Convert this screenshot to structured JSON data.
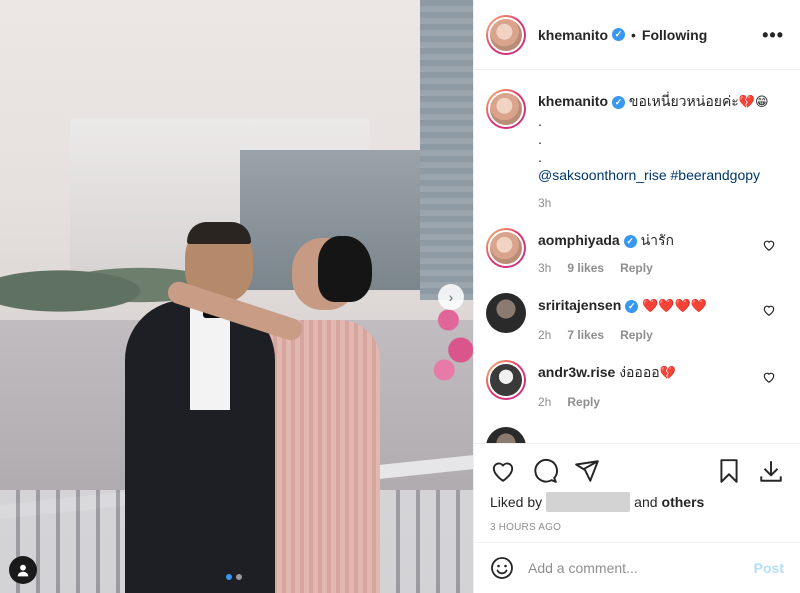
{
  "post": {
    "username": "khemanito",
    "follow_separator": "•",
    "follow_state": "Following",
    "more_label": "•••"
  },
  "caption": {
    "username": "khemanito",
    "text": "ขอเหนี่ยวหน่อยค่ะ",
    "emoji_1": "💔",
    "emoji_2": "😁",
    "dot_line_1": ".",
    "dot_line_2": ".",
    "dot_line_3": ".",
    "mention": "@saksoonthorn_rise",
    "hashtag": "#beerandgopy",
    "time": "3h"
  },
  "comments": [
    {
      "username": "aomphiyada",
      "verified": true,
      "text": "น่ารัก",
      "time": "3h",
      "likes": "9 likes",
      "reply": "Reply"
    },
    {
      "username": "sriritajensen",
      "verified": true,
      "text": "❤️❤️❤️❤️",
      "time": "2h",
      "likes": "7 likes",
      "reply": "Reply"
    },
    {
      "username": "andr3w.rise",
      "verified": false,
      "text": "ง่ออออ",
      "emoji": "💔",
      "time": "2h",
      "likes": "",
      "reply": "Reply"
    }
  ],
  "likes": {
    "prefix": "Liked by",
    "connector": "and",
    "others": "others"
  },
  "timestamp": "3 HOURS AGO",
  "add_comment": {
    "placeholder": "Add a comment...",
    "post_label": "Post"
  },
  "carousel": {
    "current": 1,
    "total": 2,
    "next_label": "›"
  },
  "colors": {
    "accent": "#3897f0",
    "link": "#00376b",
    "muted": "#8e8e8e",
    "post_disabled": "#b2dffc",
    "heart_red": "#e0245e"
  }
}
